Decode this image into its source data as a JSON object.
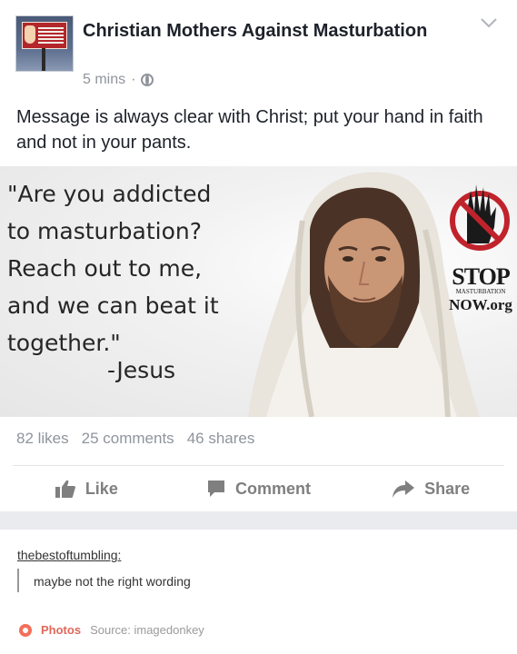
{
  "post": {
    "page_name": "Christian Mothers Against Masturbation",
    "timestamp": "5 mins",
    "separator_dot": "·",
    "privacy_icon": "globe-icon",
    "message": "Message is always clear with Christ; put your hand in faith and not in your pants."
  },
  "image": {
    "quote_text": "\"Are you addicted\nto masturbation?\nReach out to me,\nand we can beat it\ntogether.\"",
    "attribution": "-Jesus",
    "logo_stop": "STOP",
    "logo_small": "MASTURBATION",
    "logo_now": "NOW.org"
  },
  "stats": {
    "likes": "82 likes",
    "comments": "25 comments",
    "shares": "46 shares"
  },
  "actions": {
    "like": "Like",
    "comment": "Comment",
    "share": "Share"
  },
  "tumblr": {
    "reblog_user": "thebestoftumbling",
    "colon": ":",
    "reblog_text": "maybe not the right wording",
    "photos_label": "Photos",
    "source": "Source: imagedonkey"
  },
  "colors": {
    "text": "#1d2129",
    "muted": "#90949c",
    "action": "#7f7f7f",
    "separator": "#e9ebee",
    "tumblr_accent": "#e0685a"
  }
}
